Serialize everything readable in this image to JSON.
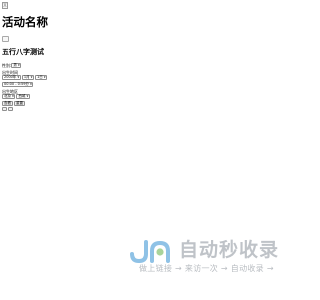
{
  "broken_image": {
    "alt_text": "X"
  },
  "activity": {
    "title": "活动名称"
  },
  "section": {
    "title": "五行八字测试"
  },
  "form": {
    "gender": {
      "label": "性别:",
      "selected": "男"
    },
    "birth_date": {
      "label": "出生时间",
      "year": "2000年",
      "month": "1月",
      "day": "1日"
    },
    "birth_hour": {
      "selected": "00:00 - 0:59分"
    },
    "birth_place": {
      "label": "出生地区",
      "province": "北京",
      "city": "西城"
    },
    "buttons": {
      "query": "查看",
      "reset": "重置"
    }
  },
  "watermark": {
    "title": "自动秒收录",
    "subtitle": "做上链接 → 来访一次 → 自动收录 →"
  },
  "colors": {
    "watermark_gray": "#bfc3c8",
    "watermark_blue": "#8fc2e6",
    "watermark_green": "#a9d39a"
  }
}
